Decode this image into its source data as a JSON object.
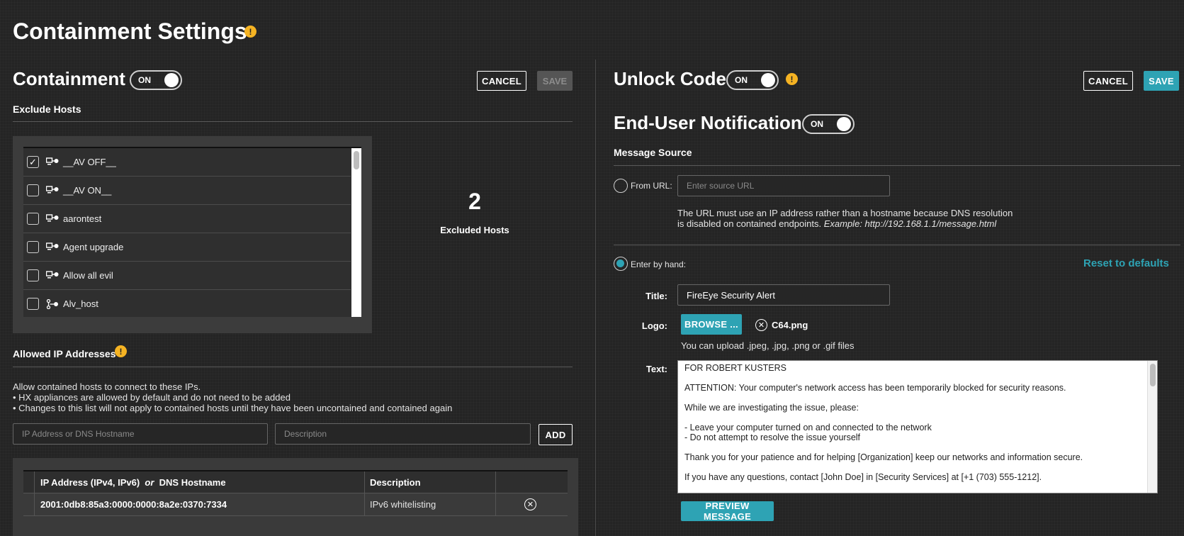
{
  "page": {
    "title": "Containment Settings"
  },
  "containment": {
    "title": "Containment",
    "toggle": "ON",
    "cancel_label": "CANCEL",
    "save_label": "SAVE",
    "exclude_hosts_label": "Exclude Hosts",
    "hosts": [
      {
        "name": "__AV OFF__",
        "checked": true,
        "icon": "host-group-icon"
      },
      {
        "name": "__AV ON__",
        "checked": false,
        "icon": "host-group-icon"
      },
      {
        "name": "aarontest",
        "checked": false,
        "icon": "host-group-icon"
      },
      {
        "name": "Agent upgrade",
        "checked": false,
        "icon": "host-group-icon"
      },
      {
        "name": "Allow all evil",
        "checked": false,
        "icon": "host-group-icon"
      },
      {
        "name": "Alv_host",
        "checked": false,
        "icon": "host-icon"
      }
    ],
    "excluded_count": "2",
    "excluded_label": "Excluded Hosts"
  },
  "allowed_ip": {
    "title": "Allowed IP Addresses",
    "intro": "Allow contained hosts to connect to these IPs.",
    "bullets": [
      "HX appliances are allowed by default and do not need to be added",
      "Changes to this list will not apply to contained hosts until they have been uncontained and contained again"
    ],
    "ip_placeholder": "IP Address or DNS Hostname",
    "desc_placeholder": "Description",
    "add_label": "ADD",
    "table": {
      "col_ip_a": "IP Address (IPv4, IPv6)",
      "col_ip_or": "or",
      "col_ip_b": "DNS Hostname",
      "col_desc": "Description",
      "rows": [
        {
          "ip": "2001:0db8:85a3:0000:0000:8a2e:0370:7334",
          "description": "IPv6 whitelisting"
        }
      ]
    }
  },
  "unlock": {
    "title": "Unlock Code",
    "toggle": "ON",
    "cancel_label": "CANCEL",
    "save_label": "SAVE"
  },
  "notification": {
    "title": "End-User Notification",
    "toggle": "ON",
    "message_source_label": "Message Source",
    "from_url_label": "From URL:",
    "url_placeholder": "Enter source URL",
    "url_help_1": "The URL must use an IP address rather than a hostname because DNS resolution",
    "url_help_2": "is disabled on contained endpoints.",
    "url_help_example": "Example: http://192.168.1.1/message.html",
    "by_hand_label": "Enter by hand:",
    "reset_label": "Reset to defaults",
    "title_label": "Title:",
    "title_value": "FireEye Security Alert",
    "logo_label": "Logo:",
    "browse_label": "BROWSE ...",
    "logo_file": "C64.png",
    "logo_help": "You can upload .jpeg, .jpg, .png or .gif files",
    "text_label": "Text:",
    "text_value": "FOR ROBERT KUSTERS\n\nATTENTION: Your computer's network access has been temporarily blocked for security reasons.\n\nWhile we are investigating the issue, please:\n\n- Leave your computer turned on and connected to the network\n- Do not attempt to resolve the issue yourself\n\nThank you for your patience and for helping [Organization] keep our networks and information secure.\n\nIf you have any questions, contact [John Doe] in [Security Services] at [+1 (703) 555-1212].",
    "preview_label": "PREVIEW MESSAGE"
  },
  "colors": {
    "accent": "#2ea3b4",
    "warning": "#f5b323",
    "background": "#242424"
  }
}
